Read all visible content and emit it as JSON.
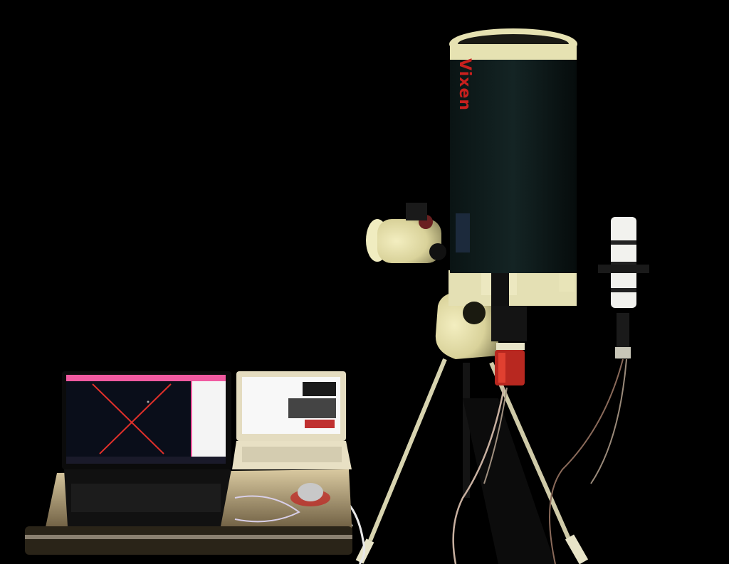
{
  "scene": {
    "description_label": "",
    "background_color": "#000000",
    "telescope": {
      "brand_text": "Vixen",
      "tube_color": "#0e1a1a",
      "mount_color": "#e8e4b0",
      "brand_color": "#c8201e"
    },
    "laptop_left": {
      "screen_colors": {
        "frame": "#f05aa0",
        "sky": "#0a0e1a",
        "crosshair": "#e0302a",
        "panel": "#f4f4f4"
      }
    },
    "laptop_right": {
      "screen_colors": {
        "bg": "#f8f8f8",
        "accent": "#c03030"
      }
    }
  }
}
